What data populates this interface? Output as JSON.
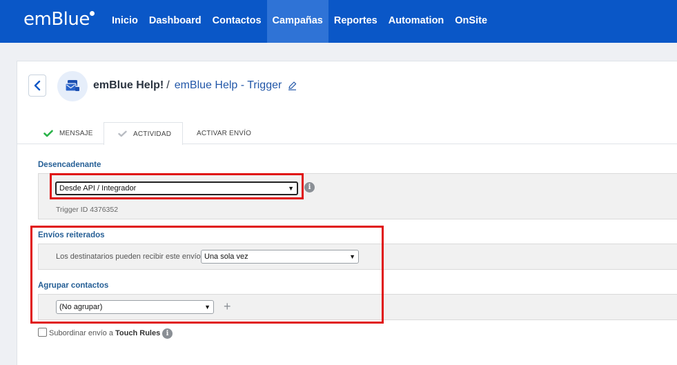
{
  "brand": {
    "logo": "emBlue"
  },
  "nav": {
    "items": [
      {
        "label": "Inicio"
      },
      {
        "label": "Dashboard"
      },
      {
        "label": "Contactos"
      },
      {
        "label": "Campañas",
        "active": true
      },
      {
        "label": "Reportes"
      },
      {
        "label": "Automation"
      },
      {
        "label": "OnSite"
      }
    ]
  },
  "header": {
    "campaign": "emBlue Help!",
    "separator": "/",
    "trigger": "emBlue Help - Trigger"
  },
  "tabs": {
    "mensaje": "MENSAJE",
    "actividad": "ACTIVIDAD",
    "activar": "ACTIVAR ENVÍO"
  },
  "desencadenante": {
    "label": "Desencadenante",
    "selected": "Desde API / Integrador",
    "trigger_id": "Trigger ID 4376352"
  },
  "envios": {
    "label": "Envíos reiterados",
    "text": "Los destinatarios pueden recibir este envío",
    "selected": "Una sola vez"
  },
  "agrupar": {
    "label": "Agrupar contactos",
    "selected": "(No agrupar)"
  },
  "subordinar": {
    "text": "Subordinar envío a",
    "bold": "Touch Rules"
  },
  "colors": {
    "topbar": "#0a57c7",
    "nav_active": "#2f73d6",
    "section_label": "#245e95",
    "highlight": "#e01010",
    "check_green": "#2bb34a"
  },
  "icons": [
    "back-chevron-icon",
    "campaign-icon",
    "edit-pencil-icon",
    "check-icon",
    "info-icon",
    "plus-icon"
  ]
}
